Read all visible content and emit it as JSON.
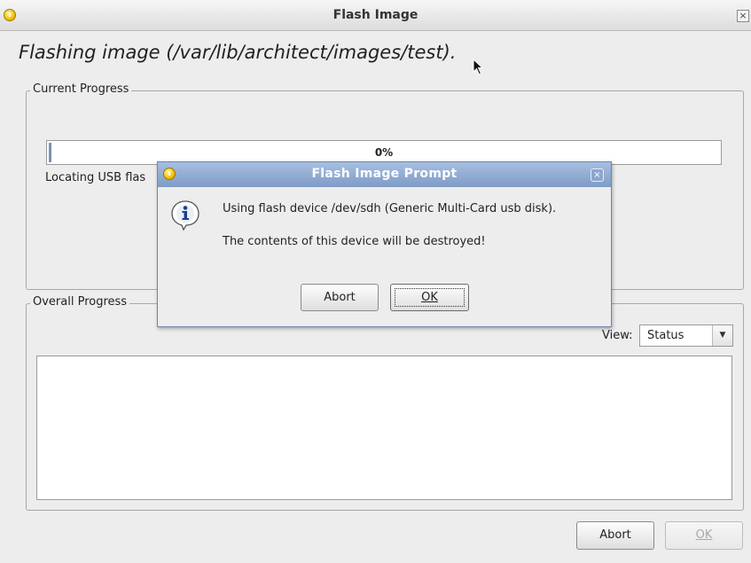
{
  "window": {
    "title": "Flash Image",
    "close_glyph": "×",
    "heading": "Flashing image (/var/lib/architect/images/test)."
  },
  "current_progress": {
    "group_label": "Current Progress",
    "progress_text": "0%",
    "progress_value": 0,
    "status_text": "Locating USB flas"
  },
  "overall_progress": {
    "group_label": "Overall Progress",
    "view_label": "View:",
    "view_selected": "Status",
    "dropdown_arrow": "▼"
  },
  "footer": {
    "abort_label": "Abort",
    "ok_label": "OK"
  },
  "dialog": {
    "title": "Flash Image Prompt",
    "close_glyph": "×",
    "icon": "info-icon",
    "message_line1": "Using flash device /dev/sdh (Generic Multi-Card usb disk).",
    "message_line2": "The contents of this device will be destroyed!",
    "abort_label": "Abort",
    "ok_label": "OK"
  },
  "colors": {
    "dialog_title_bar": "#8da8d2",
    "progress_fill": "#7793b6",
    "window_bg": "#ededed"
  }
}
